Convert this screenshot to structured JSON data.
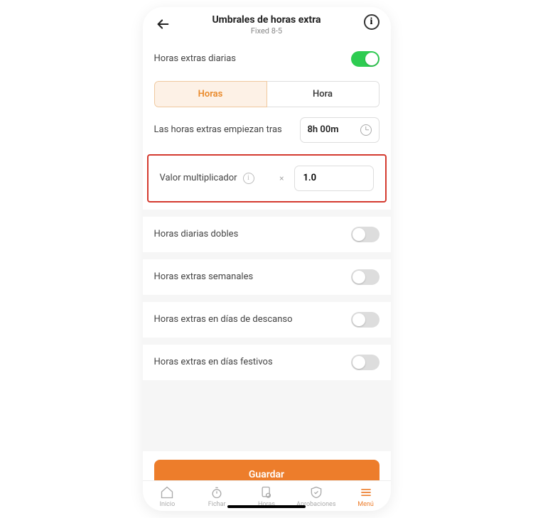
{
  "header": {
    "title": "Umbrales de horas extra",
    "subtitle": "Fixed 8-5"
  },
  "sections": {
    "daily_overtime": {
      "label": "Horas extras diarias",
      "enabled": true
    },
    "segment": {
      "hours": "Horas",
      "hour": "Hora"
    },
    "start_after": {
      "label": "Las horas extras empiezan tras",
      "value": "8h 00m"
    },
    "multiplier": {
      "label": "Valor multiplicador",
      "symbol": "×",
      "value": "1.0"
    },
    "double_daily": {
      "label": "Horas diarias dobles",
      "enabled": false
    },
    "weekly": {
      "label": "Horas extras semanales",
      "enabled": false
    },
    "rest_days": {
      "label": "Horas extras en días de descanso",
      "enabled": false
    },
    "holidays": {
      "label": "Horas extras en días festivos",
      "enabled": false
    }
  },
  "save_label": "Guardar",
  "tabs": {
    "home": "Inicio",
    "clock": "Fichar",
    "hours": "Horas",
    "approvals": "Aprobaciones",
    "menu": "Menú"
  }
}
